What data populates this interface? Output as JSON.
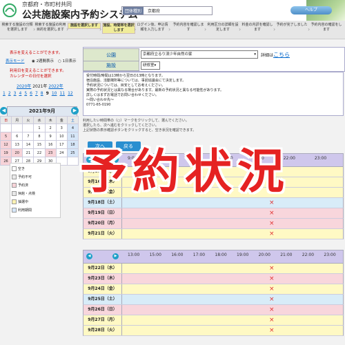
{
  "header": {
    "org": "京都府・市町村共同",
    "system_title": "公共施設案内予約システム",
    "region_label": "団体種別",
    "region_value": "京都府",
    "help_button": "ヘルプ"
  },
  "steps": [
    {
      "label": "検索する施設の分類を選択します",
      "active": false
    },
    {
      "label": "検索する施設の利用目的を選択します",
      "active": false
    },
    {
      "label": "施設を選択します",
      "active": true
    },
    {
      "label": "施設、時間帯を選択します",
      "active": true
    },
    {
      "label": "ログイン後、申込情報を入力します",
      "active": false
    },
    {
      "label": "予約内容を確認します",
      "active": false
    },
    {
      "label": "利用区分の詳細を設定します",
      "active": false
    },
    {
      "label": "料金の内訳を確認します",
      "active": false
    },
    {
      "label": "予約が完了しました",
      "active": false
    },
    {
      "label": "予約内容の確認をします",
      "active": false
    }
  ],
  "sidebar": {
    "display_mode_prompt": "表示を変えることができます。",
    "display_mode_label": "表示モード",
    "mode_two_weeks": "2週間表示",
    "mode_one_day": "1日表示",
    "date_prompt": "利用日を変えることができます。",
    "calendar_prompt": "カレンダーの日付を選択",
    "year_links": [
      "2020年",
      "2021年",
      "2022年"
    ],
    "months": [
      "1",
      "2",
      "3",
      "4",
      "5",
      "6",
      "7",
      "8",
      "9",
      "10",
      "11",
      "12"
    ],
    "calendar_title": "2021年9月",
    "weekdays": [
      "日",
      "月",
      "火",
      "水",
      "木",
      "金",
      "土"
    ],
    "calendar_rows": [
      [
        "",
        "",
        "",
        "1",
        "2",
        "3",
        "4"
      ],
      [
        "5",
        "6",
        "7",
        "8",
        "9",
        "10",
        "11"
      ],
      [
        "12",
        "13",
        "14",
        "15",
        "16",
        "17",
        "18"
      ],
      [
        "19",
        "20",
        "21",
        "22",
        "23",
        "24",
        "25"
      ],
      [
        "26",
        "27",
        "28",
        "29",
        "30",
        "",
        ""
      ]
    ],
    "legend": [
      {
        "label": "空き",
        "color": "#ffffff"
      },
      {
        "label": "予約不可",
        "color": "#e9e9e9"
      },
      {
        "label": "予約済",
        "color": "#f7d3d8"
      },
      {
        "label": "休館・点検",
        "color": "#e8e8e8"
      },
      {
        "label": "抽選中",
        "color": "#fff2b3"
      },
      {
        "label": "利用期間",
        "color": "#d6e6f8"
      }
    ]
  },
  "facility": {
    "row1_label": "公園",
    "row1_value": "京都府立るり渓少年自然の家",
    "row1_detail": "詳細は",
    "row1_link": "こちら",
    "row2_label": "施設",
    "row2_value": "研修室"
  },
  "notes": [
    "受付時間/時間は13時から翌日の13時となります。",
    "宿泊施設、活動場所等については、事前協議会にて決定します。",
    "予約状況については、目安としてお考えください。",
    "実際の予約状況とは異なる場合があります。最新の予約状況と異なる可能性があります。",
    "詳しくはまずお電話でお問い合わせください。",
    "〜問い合わせ先〜",
    "0771-65-0190"
  ],
  "instructions": [
    "利用したい時間帯の（○）マークをクリックして、選んでください。",
    "選択したら、次へ進むをクリックしてください。",
    "上記状態の表示確認ボタンをクリックすると、空き状況を確認できます。"
  ],
  "buttons": {
    "next": "次へ",
    "prev": "戻る"
  },
  "schedule": {
    "year_label": "2021",
    "hours1": [
      "9:00",
      "12:00",
      "15:00",
      "18:00",
      "21:00",
      "22:00",
      "23:00"
    ],
    "hours2": [
      "13:00",
      "15:00",
      "16:00",
      "17:00",
      "18:00",
      "19:00",
      "20:00",
      "21:00",
      "22:00",
      "23:00"
    ],
    "days1": [
      {
        "date": "9月15日（水）",
        "color": "#fff9c4",
        "mark": "×"
      },
      {
        "date": "9月16日（木）",
        "color": "#fff9c4",
        "mark": "×"
      },
      {
        "date": "9月17日（金）",
        "color": "#fff9c4",
        "mark": "×"
      },
      {
        "date": "9月18日（土）",
        "color": "#d8ecf8",
        "mark": "×"
      },
      {
        "date": "9月19日（日）",
        "color": "#f8d6dc",
        "mark": "×"
      },
      {
        "date": "9月20日（月）",
        "color": "#f8d6dc",
        "mark": "×"
      },
      {
        "date": "9月21日（火）",
        "color": "#fff9c4",
        "mark": "×"
      }
    ],
    "days2": [
      {
        "date": "9月22日（水）",
        "color": "#fff9c4",
        "mark": "×"
      },
      {
        "date": "9月23日（木）",
        "color": "#f8d6dc",
        "mark": "×"
      },
      {
        "date": "9月24日（金）",
        "color": "#fff9c4",
        "mark": "×"
      },
      {
        "date": "9月25日（土）",
        "color": "#d8ecf8",
        "mark": "×"
      },
      {
        "date": "9月26日（日）",
        "color": "#f8d6dc",
        "mark": "×"
      },
      {
        "date": "9月27日（月）",
        "color": "#fff9c4",
        "mark": "×"
      },
      {
        "date": "9月28日（火）",
        "color": "#fff9c4",
        "mark": "×"
      }
    ]
  },
  "overlay_text": "予約状況"
}
